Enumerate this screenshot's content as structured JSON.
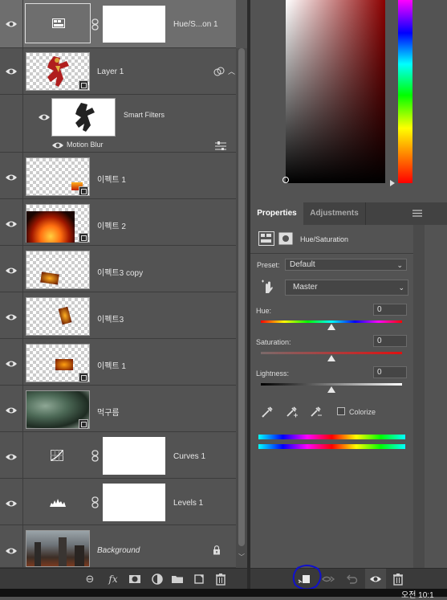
{
  "layers": [
    {
      "name": "Hue/S...on 1",
      "type": "adjustment",
      "icon": "hue-saturation-icon",
      "selected": true
    },
    {
      "name": "Layer 1",
      "type": "smart-object",
      "icon": "ironman-figure"
    },
    {
      "name": "Smart Filters",
      "type": "smart-filters"
    },
    {
      "name": "Motion Blur",
      "type": "filter"
    },
    {
      "name": "이펙트 1",
      "type": "smart-object",
      "icon": "fire-small"
    },
    {
      "name": "이펙트 2",
      "type": "smart-object",
      "icon": "fire-large"
    },
    {
      "name": "이펙트3 copy",
      "type": "smart-object",
      "icon": "fire-shard"
    },
    {
      "name": "이펙트3",
      "type": "smart-object",
      "icon": "fire-shard"
    },
    {
      "name": "이펙트 1",
      "type": "smart-object",
      "icon": "fire-small"
    },
    {
      "name": "먹구름",
      "type": "smart-object",
      "icon": "storm-clouds"
    },
    {
      "name": "Curves 1",
      "type": "adjustment",
      "icon": "curves-icon"
    },
    {
      "name": "Levels 1",
      "type": "adjustment",
      "icon": "levels-icon"
    },
    {
      "name": "Background",
      "type": "background",
      "icon": "city-ruins",
      "locked": true
    }
  ],
  "layers_toolbar": [
    "link-icon",
    "fx-icon",
    "mask-icon",
    "adjustment-icon",
    "folder-icon",
    "new-layer-icon",
    "trash-icon"
  ],
  "properties": {
    "tabs": [
      "Properties",
      "Adjustments"
    ],
    "panel_title": "Hue/Saturation",
    "preset_label": "Preset:",
    "preset_value": "Default",
    "channel_value": "Master",
    "hue_label": "Hue:",
    "hue_value": "0",
    "saturation_label": "Saturation:",
    "saturation_value": "0",
    "lightness_label": "Lightness:",
    "lightness_value": "0",
    "colorize_label": "Colorize",
    "colorize_checked": false
  },
  "properties_toolbar": [
    "clip-to-layer-icon",
    "view-previous-icon",
    "reset-icon",
    "visibility-icon",
    "trash-icon"
  ],
  "taskbar_clock": "오전 10:1",
  "colors": {
    "panel": "#535353",
    "dark": "#3a3a3a",
    "accent": "#ffffff",
    "annotation": "#1010cc"
  }
}
